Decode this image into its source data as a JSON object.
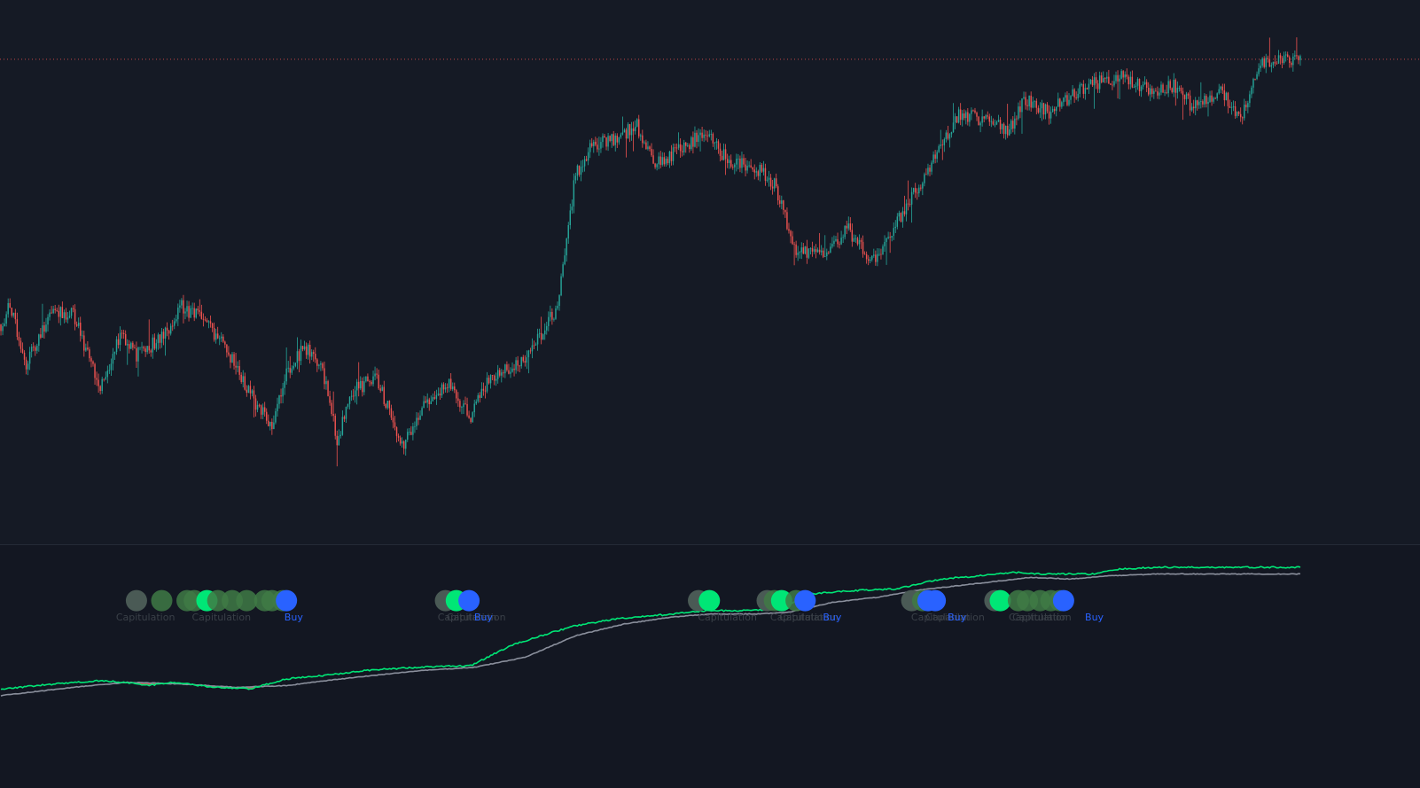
{
  "colors": {
    "background": "#151a25",
    "bull": "#26a69a",
    "bear": "#ef5350",
    "ref_line": "#ef5350",
    "fast_line": "#00e676",
    "slow_line": "#8a8f9c",
    "under_fill": "#ef5350",
    "buy": "#2962ff",
    "capitulation_text": "#3a4048",
    "dot_dim": "#4a5a55",
    "dot_mid": "#3f7a45",
    "dot_bright": "#00e676"
  },
  "chart_data": [
    {
      "type": "candlestick",
      "pane": "price",
      "title": "",
      "xlabel": "",
      "ylabel": "",
      "grid": false,
      "legend": "none",
      "reference_line": {
        "value": 100,
        "style": "dotted"
      },
      "ylim": [
        0,
        105
      ],
      "x_count": 720,
      "anchors": [
        [
          0,
          40
        ],
        [
          5,
          44
        ],
        [
          14,
          31
        ],
        [
          28,
          43
        ],
        [
          40,
          42
        ],
        [
          55,
          26
        ],
        [
          67,
          38
        ],
        [
          75,
          33
        ],
        [
          90,
          37
        ],
        [
          100,
          44
        ],
        [
          112,
          41
        ],
        [
          124,
          35
        ],
        [
          138,
          24
        ],
        [
          150,
          17
        ],
        [
          158,
          29
        ],
        [
          168,
          35
        ],
        [
          178,
          30
        ],
        [
          186,
          14
        ],
        [
          195,
          25
        ],
        [
          208,
          28
        ],
        [
          222,
          12
        ],
        [
          234,
          21
        ],
        [
          247,
          27
        ],
        [
          260,
          19
        ],
        [
          270,
          28
        ],
        [
          288,
          31
        ],
        [
          298,
          37
        ],
        [
          308,
          44
        ],
        [
          318,
          74
        ],
        [
          328,
          81
        ],
        [
          340,
          82
        ],
        [
          352,
          85
        ],
        [
          362,
          76
        ],
        [
          378,
          80
        ],
        [
          390,
          84
        ],
        [
          402,
          77
        ],
        [
          416,
          76
        ],
        [
          428,
          72
        ],
        [
          440,
          56
        ],
        [
          458,
          56
        ],
        [
          468,
          62
        ],
        [
          482,
          54
        ],
        [
          494,
          62
        ],
        [
          510,
          73
        ],
        [
          530,
          88
        ],
        [
          546,
          86
        ],
        [
          558,
          84
        ],
        [
          566,
          91
        ],
        [
          580,
          88
        ],
        [
          600,
          94
        ],
        [
          620,
          96
        ],
        [
          636,
          93
        ],
        [
          650,
          94
        ],
        [
          660,
          89
        ],
        [
          674,
          93
        ],
        [
          686,
          87
        ],
        [
          698,
          99
        ],
        [
          719,
          100
        ]
      ]
    },
    {
      "type": "line",
      "pane": "indicator",
      "title": "",
      "xlabel": "",
      "ylabel": "",
      "grid": false,
      "legend": "none",
      "ylim": [
        0,
        100
      ],
      "x_count": 720,
      "fast_anchors": [
        [
          0,
          19
        ],
        [
          30,
          22
        ],
        [
          55,
          24
        ],
        [
          70,
          23
        ],
        [
          80,
          21
        ],
        [
          95,
          23
        ],
        [
          118,
          20
        ],
        [
          138,
          19
        ],
        [
          158,
          25
        ],
        [
          178,
          27
        ],
        [
          200,
          30
        ],
        [
          230,
          32
        ],
        [
          260,
          33
        ],
        [
          282,
          45
        ],
        [
          302,
          52
        ],
        [
          318,
          57
        ],
        [
          340,
          61
        ],
        [
          362,
          63
        ],
        [
          390,
          66
        ],
        [
          410,
          66
        ],
        [
          432,
          67
        ],
        [
          448,
          76
        ],
        [
          470,
          78
        ],
        [
          495,
          79
        ],
        [
          520,
          85
        ],
        [
          542,
          87
        ],
        [
          560,
          89
        ],
        [
          575,
          88
        ],
        [
          590,
          88
        ],
        [
          604,
          88
        ],
        [
          620,
          91
        ],
        [
          640,
          92
        ],
        [
          660,
          92
        ],
        [
          680,
          92
        ],
        [
          719,
          92
        ]
      ],
      "slow_anchors": [
        [
          0,
          15
        ],
        [
          40,
          20
        ],
        [
          70,
          23
        ],
        [
          100,
          22
        ],
        [
          130,
          20
        ],
        [
          158,
          21
        ],
        [
          180,
          24
        ],
        [
          205,
          27
        ],
        [
          232,
          30
        ],
        [
          262,
          32
        ],
        [
          290,
          38
        ],
        [
          318,
          51
        ],
        [
          345,
          58
        ],
        [
          370,
          62
        ],
        [
          392,
          64
        ],
        [
          418,
          64
        ],
        [
          436,
          65
        ],
        [
          460,
          71
        ],
        [
          485,
          74
        ],
        [
          505,
          78
        ],
        [
          530,
          81
        ],
        [
          554,
          84
        ],
        [
          570,
          86
        ],
        [
          592,
          85
        ],
        [
          615,
          87
        ],
        [
          640,
          88
        ],
        [
          660,
          88
        ],
        [
          680,
          88
        ],
        [
          719,
          88
        ]
      ],
      "signals": [
        {
          "x": 80,
          "kind": "capitulation",
          "text": "Capitulation"
        },
        {
          "x": 122,
          "kind": "capitulation",
          "text": "Capitulation"
        },
        {
          "x": 162,
          "kind": "buy",
          "text": "Buy"
        },
        {
          "x": 258,
          "kind": "capitulation",
          "text": "Capitulation"
        },
        {
          "x": 263,
          "kind": "capitulation",
          "text": "Capitulation"
        },
        {
          "x": 267,
          "kind": "buy",
          "text": "Buy"
        },
        {
          "x": 402,
          "kind": "capitulation",
          "text": "Capitulation"
        },
        {
          "x": 442,
          "kind": "capitulation",
          "text": "Capitulation"
        },
        {
          "x": 447,
          "kind": "capitulation",
          "text": "Capitulation"
        },
        {
          "x": 460,
          "kind": "buy",
          "text": "Buy"
        },
        {
          "x": 520,
          "kind": "capitulation",
          "text": "Capitulation"
        },
        {
          "x": 528,
          "kind": "capitulation",
          "text": "Capitulation"
        },
        {
          "x": 529,
          "kind": "buy",
          "text": "Buy"
        },
        {
          "x": 574,
          "kind": "capitulation",
          "text": "Capitulation"
        },
        {
          "x": 576,
          "kind": "capitulation",
          "text": "Capitulation"
        },
        {
          "x": 605,
          "kind": "buy",
          "text": "Buy"
        }
      ],
      "dots": [
        {
          "x": 75,
          "shade": "dim"
        },
        {
          "x": 89,
          "shade": "mid"
        },
        {
          "x": 103,
          "shade": "mid"
        },
        {
          "x": 107,
          "shade": "mid"
        },
        {
          "x": 114,
          "shade": "bright"
        },
        {
          "x": 120,
          "shade": "mid"
        },
        {
          "x": 128,
          "shade": "mid"
        },
        {
          "x": 136,
          "shade": "mid"
        },
        {
          "x": 146,
          "shade": "mid"
        },
        {
          "x": 150,
          "shade": "mid"
        },
        {
          "x": 156,
          "shade": "mid"
        },
        {
          "x": 158,
          "shade": "buy"
        },
        {
          "x": 246,
          "shade": "dim"
        },
        {
          "x": 252,
          "shade": "bright"
        },
        {
          "x": 259,
          "shade": "buy"
        },
        {
          "x": 386,
          "shade": "dim"
        },
        {
          "x": 392,
          "shade": "bright"
        },
        {
          "x": 424,
          "shade": "dim"
        },
        {
          "x": 428,
          "shade": "mid"
        },
        {
          "x": 432,
          "shade": "bright"
        },
        {
          "x": 440,
          "shade": "mid"
        },
        {
          "x": 445,
          "shade": "buy"
        },
        {
          "x": 504,
          "shade": "dim"
        },
        {
          "x": 510,
          "shade": "mid"
        },
        {
          "x": 513,
          "shade": "buy"
        },
        {
          "x": 517,
          "shade": "buy"
        },
        {
          "x": 550,
          "shade": "dim"
        },
        {
          "x": 553,
          "shade": "bright"
        },
        {
          "x": 563,
          "shade": "mid"
        },
        {
          "x": 568,
          "shade": "mid"
        },
        {
          "x": 575,
          "shade": "mid"
        },
        {
          "x": 581,
          "shade": "mid"
        },
        {
          "x": 586,
          "shade": "mid"
        },
        {
          "x": 588,
          "shade": "buy"
        }
      ],
      "dots_level": 72,
      "labels_level": 60
    }
  ]
}
